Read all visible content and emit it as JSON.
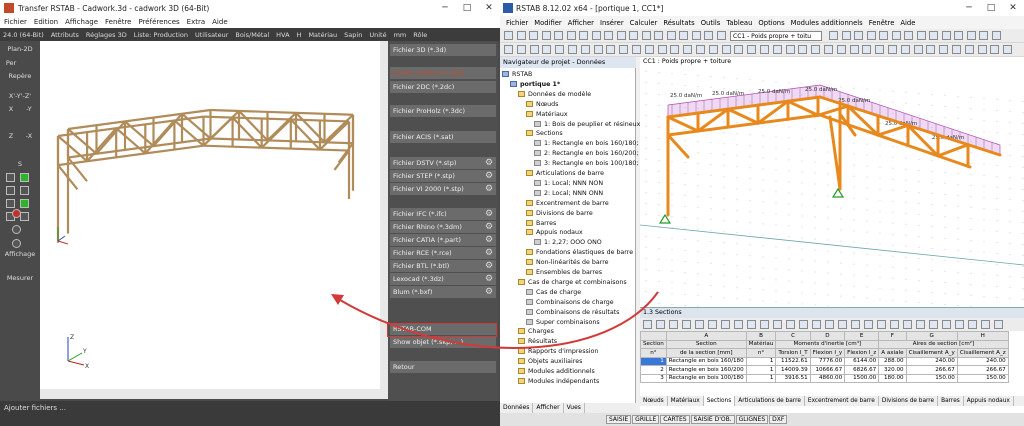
{
  "cadwork": {
    "title": "Transfer RSTAB - Cadwork.3d - cadwork 3D (64-Bit)",
    "menu": [
      "Fichier",
      "Edition",
      "Affichage",
      "Fenêtre",
      "Préférences",
      "Extra",
      "Aide"
    ],
    "toolbar": [
      "24.0 (64-Bit)",
      "Attributs",
      "Réglages 3D",
      "Liste: Production",
      "Utilisateur",
      "Bois/Métal",
      "HVA",
      "H",
      "Matériau",
      "Sapin",
      "Unité",
      "mm",
      "Rôle"
    ],
    "left_tools": [
      "Plan-2D",
      "Per",
      "Repère",
      "X'-Y'-Z'",
      "X",
      "-Y",
      "Z",
      "-X",
      "S",
      "Affichage",
      "Mesurer"
    ],
    "export_buttons": [
      {
        "label": "Fichier 3D (*.3d)",
        "gear": false,
        "disabled": false
      },
      {
        "label": "Fichier surface (*.3ds)",
        "gear": false,
        "disabled": true
      },
      {
        "label": "Fichier 2DC (*.2dc)",
        "gear": false,
        "disabled": false
      },
      {
        "label": "Fichier ProHolz (*.3dc)",
        "gear": false,
        "disabled": false
      },
      {
        "label": "Fichier ACIS (*.sat)",
        "gear": false,
        "disabled": false
      },
      {
        "label": "Fichier DSTV (*.stp)",
        "gear": true,
        "disabled": false
      },
      {
        "label": "Fichier STEP (*.stp)",
        "gear": true,
        "disabled": false
      },
      {
        "label": "Fichier VI 2000 (*.stp)",
        "gear": true,
        "disabled": false
      },
      {
        "label": "Fichier IFC (*.ifc)",
        "gear": true,
        "disabled": false
      },
      {
        "label": "Fichier Rhino (*.3dm)",
        "gear": true,
        "disabled": false
      },
      {
        "label": "Fichier CATIA (*.part)",
        "gear": true,
        "disabled": false
      },
      {
        "label": "Fichier RCE (*.rce)",
        "gear": true,
        "disabled": false
      },
      {
        "label": "Fichier BTL (*.btl)",
        "gear": true,
        "disabled": false
      },
      {
        "label": "Lexocad (*.3dz)",
        "gear": true,
        "disabled": false
      },
      {
        "label": "Blum (*.bxf)",
        "gear": true,
        "disabled": false
      },
      {
        "label": "RSTAB-COM",
        "gear": false,
        "disabled": false
      },
      {
        "label": "Show objet (*.skp, ...)",
        "gear": false,
        "disabled": false
      },
      {
        "label": "Retour",
        "gear": false,
        "disabled": false
      }
    ],
    "status": "Ajouter fichiers ...",
    "axis": {
      "x": "X",
      "y": "Y",
      "z": "Z"
    }
  },
  "rstab": {
    "title": "RSTAB 8.12.02 x64 - [portique 1, CC1*]",
    "menu": [
      "Fichier",
      "Modifier",
      "Afficher",
      "Insérer",
      "Calculer",
      "Résultats",
      "Outils",
      "Tableau",
      "Options",
      "Modules additionnels",
      "Fenêtre",
      "Aide"
    ],
    "loadcase": "CC1 - Poids propre + toitu",
    "navigator": {
      "title": "Navigateur de projet - Données",
      "tree": [
        {
          "d": 0,
          "t": "RSTAB",
          "i": "blue"
        },
        {
          "d": 1,
          "t": "portique 1*",
          "i": "blue",
          "bold": true
        },
        {
          "d": 2,
          "t": "Données de modèle",
          "i": "f"
        },
        {
          "d": 3,
          "t": "Nœuds",
          "i": "f"
        },
        {
          "d": 3,
          "t": "Matériaux",
          "i": "f"
        },
        {
          "d": 4,
          "t": "1: Bois de peuplier et résineux",
          "i": "gray"
        },
        {
          "d": 3,
          "t": "Sections",
          "i": "f"
        },
        {
          "d": 4,
          "t": "1: Rectangle en bois 160/180;",
          "i": "gray"
        },
        {
          "d": 4,
          "t": "2: Rectangle en bois 160/200;",
          "i": "gray"
        },
        {
          "d": 4,
          "t": "3: Rectangle en bois 100/180;",
          "i": "gray"
        },
        {
          "d": 3,
          "t": "Articulations de barre",
          "i": "f"
        },
        {
          "d": 4,
          "t": "1: Local; NNN NON",
          "i": "gray"
        },
        {
          "d": 4,
          "t": "2: Local; NNN ONN",
          "i": "gray"
        },
        {
          "d": 3,
          "t": "Excentrement de barre",
          "i": "f"
        },
        {
          "d": 3,
          "t": "Divisions de barre",
          "i": "f"
        },
        {
          "d": 3,
          "t": "Barres",
          "i": "f"
        },
        {
          "d": 3,
          "t": "Appuis nodaux",
          "i": "f"
        },
        {
          "d": 4,
          "t": "1: 2,27; OOO ONO",
          "i": "gray"
        },
        {
          "d": 3,
          "t": "Fondations élastiques de barre",
          "i": "f"
        },
        {
          "d": 3,
          "t": "Non-linéarités de barre",
          "i": "f"
        },
        {
          "d": 3,
          "t": "Ensembles de barres",
          "i": "f"
        },
        {
          "d": 2,
          "t": "Cas de charge et combinaisons",
          "i": "f"
        },
        {
          "d": 3,
          "t": "Cas de charge",
          "i": "gray"
        },
        {
          "d": 3,
          "t": "Combinaisons de charge",
          "i": "gray"
        },
        {
          "d": 3,
          "t": "Combinaisons de résultats",
          "i": "gray"
        },
        {
          "d": 3,
          "t": "Super combinaisons",
          "i": "gray"
        },
        {
          "d": 2,
          "t": "Charges",
          "i": "f"
        },
        {
          "d": 2,
          "t": "Résultats",
          "i": "f"
        },
        {
          "d": 2,
          "t": "Rapports d'impression",
          "i": "f"
        },
        {
          "d": 2,
          "t": "Objets auxiliaires",
          "i": "f"
        },
        {
          "d": 2,
          "t": "Modules additionnels",
          "i": "f"
        },
        {
          "d": 2,
          "t": "Modules indépendants",
          "i": "f"
        }
      ],
      "tabs": [
        "Données",
        "Afficher",
        "Vues"
      ]
    },
    "view_title": "CC1 : Poids propre + toiture",
    "load_labels": [
      "25.0 daN/m",
      "25.0 daN/m",
      "25.0 daN/m",
      "25.0 daN/m",
      "25.0 daN/m",
      "25.0 daN/m",
      "25.0 daN/m"
    ],
    "table": {
      "title": "1.3 Sections",
      "head_letters": [
        "A",
        "B",
        "C",
        "D",
        "E",
        "F",
        "G",
        "H"
      ],
      "head1": [
        "Section",
        "Section",
        "Matériau",
        "Moments d'inertie [cm⁴]",
        "",
        "",
        "Aires de section [cm²]",
        "",
        ""
      ],
      "head2": [
        "n°",
        "de la section [mm]",
        "n°",
        "Torsion I_T",
        "Flexion I_y",
        "Flexion I_z",
        "A axiale",
        "Cisaillement A_y",
        "Cisaillement A_z"
      ],
      "rows": [
        [
          "1",
          "Rectangle en bois 160/180",
          "1",
          "11522.61",
          "7776.00",
          "6144.00",
          "288.00",
          "240.00",
          "240.00"
        ],
        [
          "2",
          "Rectangle en bois 160/200",
          "1",
          "14009.39",
          "10666.67",
          "6826.67",
          "320.00",
          "266.67",
          "266.67"
        ],
        [
          "3",
          "Rectangle en bois 100/180",
          "1",
          "3916.51",
          "4860.00",
          "1500.00",
          "180.00",
          "150.00",
          "150.00"
        ]
      ],
      "bottom_tabs": [
        "Nœuds",
        "Matériaux",
        "Sections",
        "Articulations de barre",
        "Excentrement de barre",
        "Divisions de barre",
        "Barres",
        "Appuis nodaux"
      ]
    },
    "status_chips": [
      "SAISIE",
      "GRILLE",
      "CARTES",
      "SAISIE D'OB.",
      "GLIGNES",
      "DXF"
    ]
  },
  "colors": {
    "accent": "#d23a3a",
    "member": "#e8891e",
    "load": "#c060c0"
  }
}
